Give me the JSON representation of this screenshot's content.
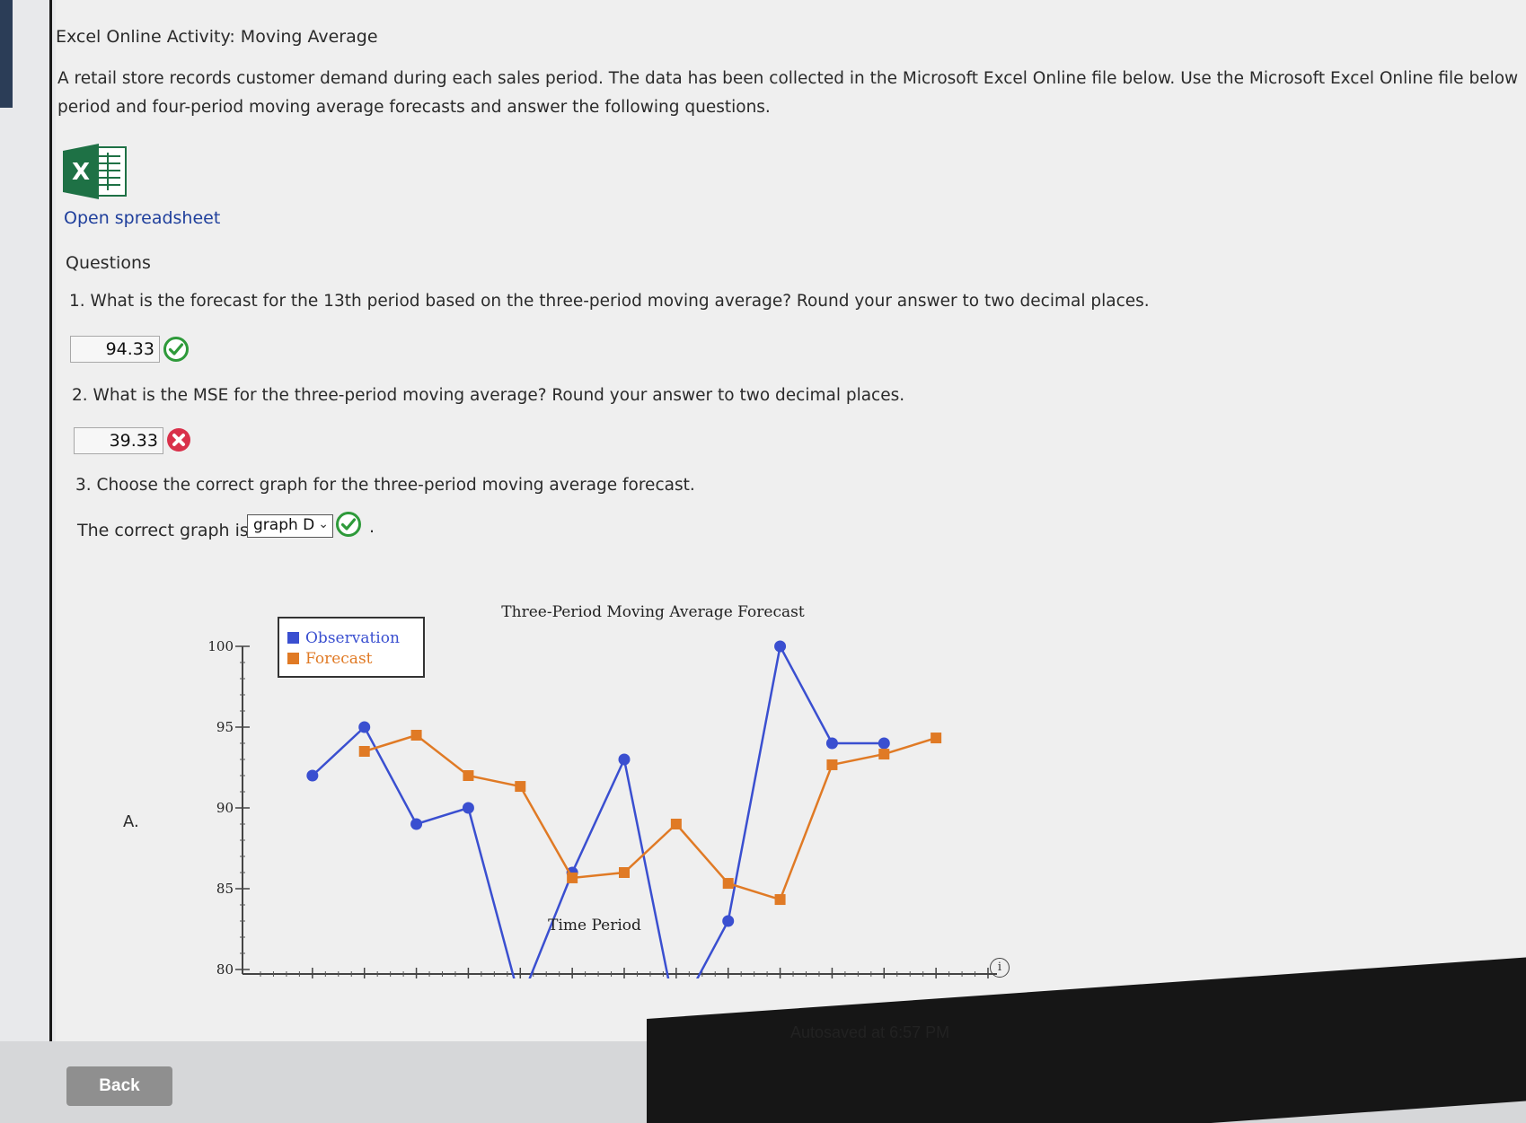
{
  "page": {
    "title": "Excel Online Activity: Moving Average",
    "intro_line1": "A retail store records customer demand during each sales period. The data has been collected in the Microsoft Excel Online file below. Use the Microsoft Excel Online file below to develop th",
    "intro_line2": "period and four-period moving average forecasts and answer the following questions.",
    "open_spreadsheet": "Open spreadsheet",
    "questions_heading": "Questions"
  },
  "questions": [
    {
      "text": "1. What is the forecast for the 13th period based on the three-period moving average? Round your answer to two decimal places.",
      "answer": "94.33",
      "status": "correct"
    },
    {
      "text": "2. What is the MSE for the three-period moving average? Round your answer to two decimal places.",
      "answer": "39.33",
      "status": "incorrect"
    },
    {
      "text": "3. Choose the correct graph for the three-period moving average forecast.",
      "prefix": "The correct graph is",
      "selected": "graph D",
      "suffix": ".",
      "status": "correct"
    }
  ],
  "graph_label": "A.",
  "colors": {
    "observation": "#3a4fd0",
    "forecast": "#e07a25",
    "correct": "#2e9a3a",
    "incorrect": "#d9304a",
    "link": "#1f3f9c"
  },
  "chart_data": {
    "type": "line",
    "title": "Three-Period Moving Average Forecast",
    "xlabel": "Time Period",
    "ylabel": "",
    "xlim": [
      0,
      14
    ],
    "ylim": [
      80,
      100
    ],
    "y_ticks": [
      "80",
      "85",
      "90",
      "95",
      "100"
    ],
    "x_ticks": [
      "1",
      "2",
      "3",
      "4",
      "5",
      "6",
      "7",
      "8",
      "9",
      "10",
      "11",
      "12",
      "13",
      "14"
    ],
    "legend": [
      "Observation",
      "Forecast"
    ],
    "legend_position": "top-left",
    "series": [
      {
        "name": "Observation",
        "x": [
          1,
          2,
          3,
          4,
          5,
          6,
          7,
          8,
          9,
          10,
          11,
          12
        ],
        "values": [
          92,
          95,
          89,
          90,
          78,
          86,
          93,
          77,
          83,
          100,
          94,
          94
        ]
      },
      {
        "name": "Forecast",
        "x": [
          2,
          3,
          4,
          5,
          6,
          7,
          8,
          9,
          10,
          11,
          12,
          13
        ],
        "values": [
          93.5,
          94.5,
          92,
          91.33,
          85.67,
          86,
          89,
          85.33,
          84.33,
          92.67,
          93.33,
          94.33
        ]
      }
    ]
  },
  "footer": {
    "autosave": "Autosaved at 6:57 PM",
    "back_label": "Back"
  }
}
